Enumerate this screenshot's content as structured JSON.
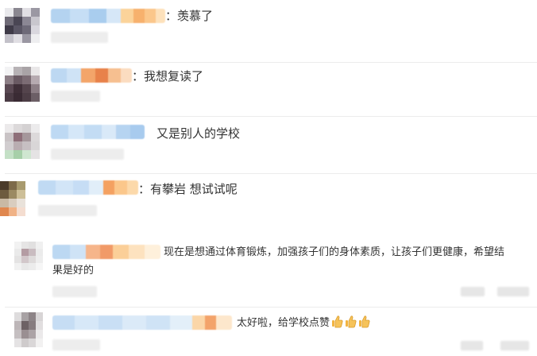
{
  "comments": [
    {
      "text": "：羡慕了"
    },
    {
      "text": "：我想复读了"
    },
    {
      "text": "又是别人的学校"
    },
    {
      "text": "：有攀岩 想试试呢"
    },
    {
      "text_line1": "现在是想通过体育锻炼，加强孩子们的身体素质，让孩子们更健康，希望结",
      "text_line2": "果是好的"
    },
    {
      "text": "太好啦，给学校点赞"
    }
  ],
  "colors": {
    "text": "#333333",
    "name_blue": "#bcd7f0",
    "name_orange": "#f6b073",
    "divider": "#ececec",
    "thumb": "#f2b441"
  },
  "icons": [
    "thumbs-up-icon",
    "thumbs-up-icon",
    "thumbs-up-icon"
  ]
}
